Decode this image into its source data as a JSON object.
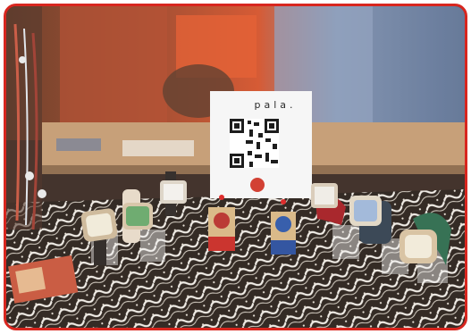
{
  "scene": {
    "sign_brand": "pala.",
    "frame_color": "#d8261f",
    "sign_color": "#f6f6f6",
    "tablecloth_color": "#2a201a",
    "icons": [
      "qr-code-icon",
      "watch-icon",
      "price-tag-icon"
    ]
  }
}
